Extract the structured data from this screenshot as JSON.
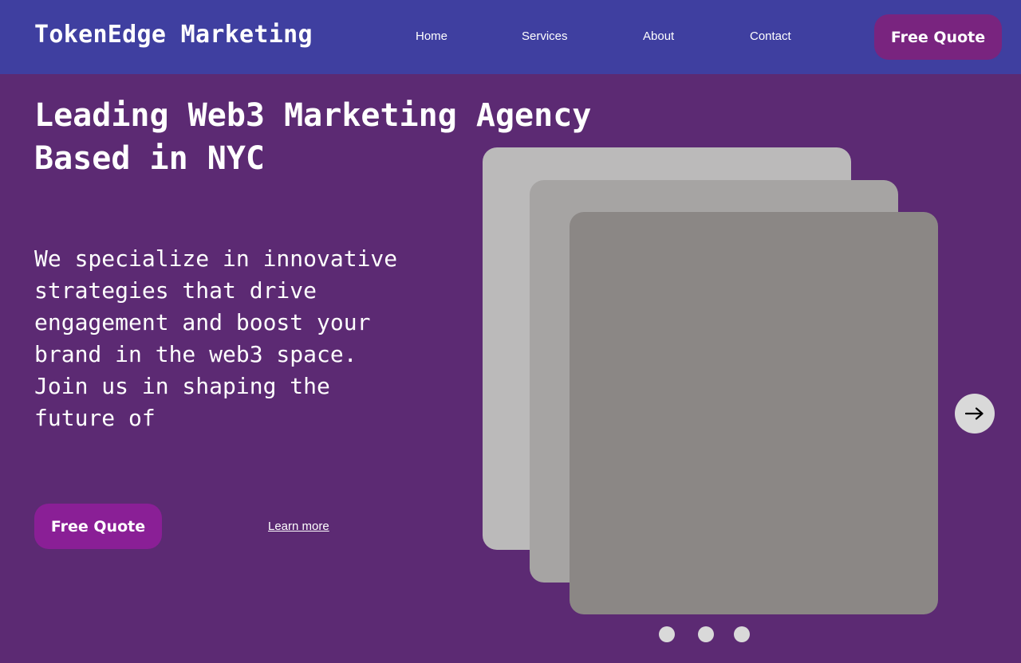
{
  "header": {
    "brand": "TokenEdge Marketing",
    "nav": {
      "home": "Home",
      "services": "Services",
      "about": "About",
      "contact": "Contact"
    },
    "cta_label": "Free Quote"
  },
  "hero": {
    "title": "Leading Web3 Marketing Agency Based in NYC",
    "body": "We specialize in innovative strategies that drive engagement and boost your brand in the web3 space.\nJoin us in shaping the future of",
    "cta_label": "Free Quote",
    "secondary_link": "Learn more"
  },
  "carousel": {
    "next_icon": "arrow-right-icon",
    "slide_count": 3,
    "active_slide": 1
  },
  "colors": {
    "page_background": "#5c2a73",
    "header_background": "#3f3fa0",
    "header_cta": "#79247f",
    "hero_cta": "#8a1f96",
    "card_back": "#bbbaba",
    "card_mid": "#a6a4a3",
    "card_front": "#8b8785",
    "control_light": "#d9d9d9"
  }
}
